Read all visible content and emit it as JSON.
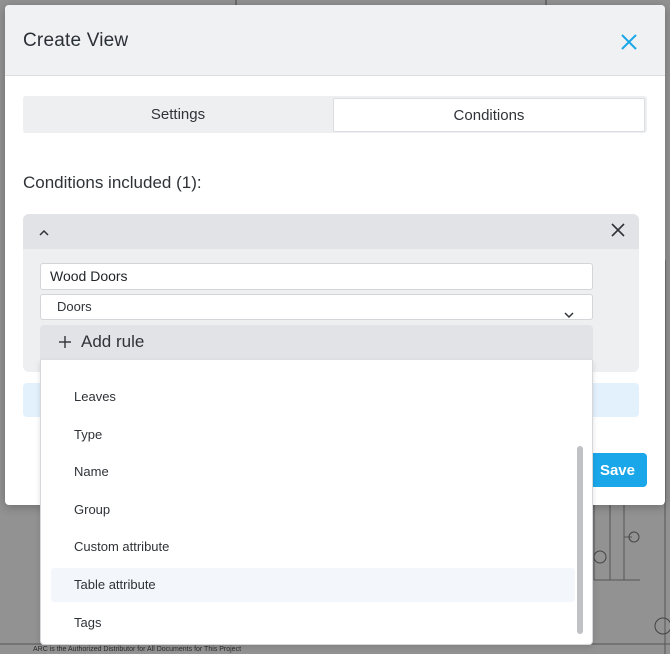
{
  "modal": {
    "title": "Create View",
    "tabs": [
      {
        "label": "Settings",
        "active": false
      },
      {
        "label": "Conditions",
        "active": true
      }
    ],
    "conditions_heading": "Conditions included (1):",
    "condition": {
      "name_value": "Wood Doors",
      "category_selected": "Doors",
      "add_rule_label": "Add rule"
    },
    "save_label": "Save"
  },
  "rule_dropdown": {
    "options": [
      {
        "label": "Leaves"
      },
      {
        "label": "Type"
      },
      {
        "label": "Name"
      },
      {
        "label": "Group"
      },
      {
        "label": "Custom attribute"
      },
      {
        "label": "Table attribute",
        "hovered": true
      },
      {
        "label": "Tags"
      }
    ]
  },
  "background": {
    "footer_text": "ARC is the Authorized Distributor for All Documents for This Project"
  },
  "colors": {
    "accent": "#1aa7ea",
    "header_bg": "#f0f1f2",
    "card_bg": "#eeeff1",
    "overlay": "#929292"
  }
}
